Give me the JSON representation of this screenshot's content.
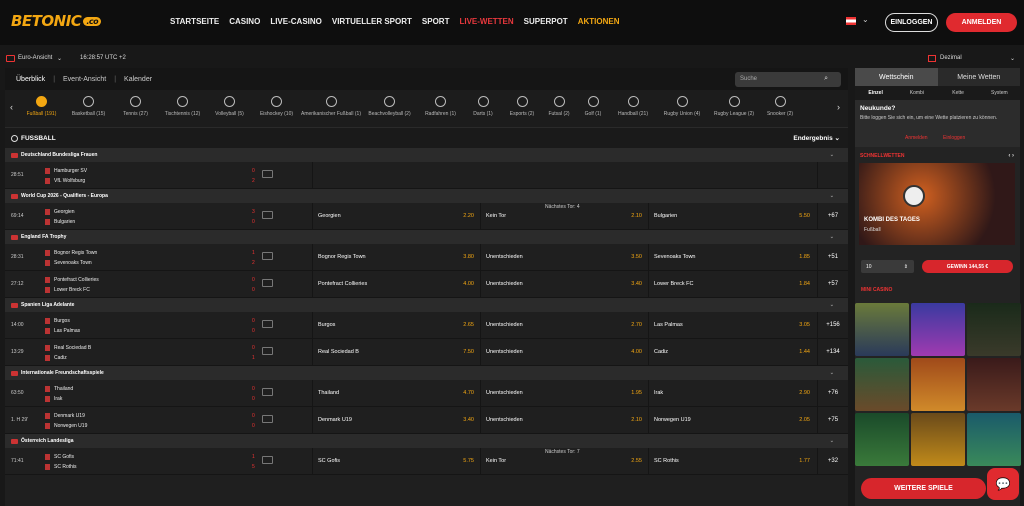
{
  "header": {
    "logo": "BETONIC",
    "logo_suffix": ".co",
    "menu": [
      "STARTSEITE",
      "CASINO",
      "LIVE-CASINO",
      "VIRTUELLER SPORT",
      "SPORT",
      "LIVE-WETTEN",
      "SUPERPOT",
      "AKTIONEN"
    ],
    "login": "EINLOGGEN",
    "register": "ANMELDEN"
  },
  "subbar": {
    "view": "Euro-Ansicht",
    "time": "16:28:57 UTC +2",
    "odds_format": "Dezimal"
  },
  "tabs": [
    "Überblick",
    "Event-Ansicht",
    "Kalender"
  ],
  "search_placeholder": "Suche",
  "sports": [
    "Fußball (191)",
    "Basketball (15)",
    "Tennis (27)",
    "Tischtennis (12)",
    "Volleyball (5)",
    "Eishockey (10)",
    "Amerikanischer Fußball (1)",
    "Beachvolleyball (2)",
    "Radfahren (1)",
    "Darts (1)",
    "Esports (2)",
    "Futsal (2)",
    "Golf (1)",
    "Handball (21)",
    "Rugby Union (4)",
    "Rugby League (2)",
    "Snooker (2)"
  ],
  "section": {
    "title": "FUSSBALL",
    "result": "Endergebnis"
  },
  "leagues": [
    {
      "name": "Deutschland Bundesliga Frauen",
      "matches": [
        {
          "time": "28:51",
          "home": "Hamburger SV",
          "away": "VfL Wolfsburg",
          "sh": "0",
          "sa": "2"
        }
      ]
    },
    {
      "name": "World Cup 2026 - Qualifiers - Europa",
      "next": "Nächstes Tor: 4",
      "matches": [
        {
          "time": "69:14",
          "home": "Georgien",
          "away": "Bulgarien",
          "sh": "3",
          "sa": "0",
          "o1": "Georgien",
          "v1": "2.20",
          "o2": "Kein Tor",
          "v2": "2.10",
          "o3": "Bulgarien",
          "v3": "5.50",
          "more": "+67"
        }
      ]
    },
    {
      "name": "England FA Trophy",
      "matches": [
        {
          "time": "28:31",
          "home": "Bognor Regis Town",
          "away": "Sevenoaks Town",
          "sh": "1",
          "sa": "2",
          "o1": "Bognor Regis Town",
          "v1": "3.80",
          "o2": "Unentschieden",
          "v2": "3.50",
          "o3": "Sevenoaks Town",
          "v3": "1.85",
          "more": "+51"
        },
        {
          "time": "27:12",
          "home": "Pontefract Collieries",
          "away": "Lower Breck FC",
          "sh": "0",
          "sa": "0",
          "o1": "Pontefract Collieries",
          "v1": "4.00",
          "o2": "Unentschieden",
          "v2": "3.40",
          "o3": "Lower Breck FC",
          "v3": "1.84",
          "more": "+57"
        }
      ]
    },
    {
      "name": "Spanien Liga Adelante",
      "matches": [
        {
          "time": "14:00",
          "home": "Burgos",
          "away": "Las Palmas",
          "sh": "0",
          "sa": "0",
          "o1": "Burgos",
          "v1": "2.65",
          "o2": "Unentschieden",
          "v2": "2.70",
          "o3": "Las Palmas",
          "v3": "3.05",
          "more": "+156"
        },
        {
          "time": "13:29",
          "home": "Real Sociedad B",
          "away": "Cadiz",
          "sh": "0",
          "sa": "1",
          "o1": "Real Sociedad B",
          "v1": "7.50",
          "o2": "Unentschieden",
          "v2": "4.00",
          "o3": "Cadiz",
          "v3": "1.44",
          "more": "+134"
        }
      ]
    },
    {
      "name": "Internationale Freundschaftsspiele",
      "matches": [
        {
          "time": "63:50",
          "home": "Thailand",
          "away": "Irak",
          "sh": "0",
          "sa": "0",
          "o1": "Thailand",
          "v1": "4.70",
          "o2": "Unentschieden",
          "v2": "1.95",
          "o3": "Irak",
          "v3": "2.90",
          "more": "+76"
        },
        {
          "time": "1. H 29'",
          "home": "Denmark U19",
          "away": "Norwegen U19",
          "sh": "0",
          "sa": "0",
          "o1": "Denmark U19",
          "v1": "3.40",
          "o2": "Unentschieden",
          "v2": "2.10",
          "o3": "Norwegen U19",
          "v3": "2.05",
          "more": "+75"
        }
      ]
    },
    {
      "name": "Österreich Landesliga",
      "next": "Nächstes Tor: 7",
      "matches": [
        {
          "time": "71:41",
          "home": "SC Gofis",
          "away": "SC Rothis",
          "sh": "1",
          "sa": "5",
          "o1": "SC Gofis",
          "v1": "5.75",
          "o2": "Kein Tor",
          "v2": "2.55",
          "o3": "SC Rothis",
          "v3": "1.77",
          "more": "+32"
        }
      ]
    }
  ],
  "sidebar": {
    "tab1": "Wettschein",
    "tab2": "Meine Wetten",
    "types": [
      "Einzel",
      "Kombi",
      "Kette",
      "System"
    ],
    "new_title": "Neukunde?",
    "new_text": "Bitte loggen Sie sich ein, um eine Wette platzieren zu können.",
    "register": "Anmelden",
    "login": "Einloggen",
    "quick": "SCHNELLWETTEN",
    "promo_title": "KOMBI DES TAGES",
    "promo_sub": "Fußball",
    "stake": "10",
    "win": "GEWINN 144,55 €",
    "mini": "MINI CASINO",
    "more_games": "WEITERE SPIELE"
  }
}
